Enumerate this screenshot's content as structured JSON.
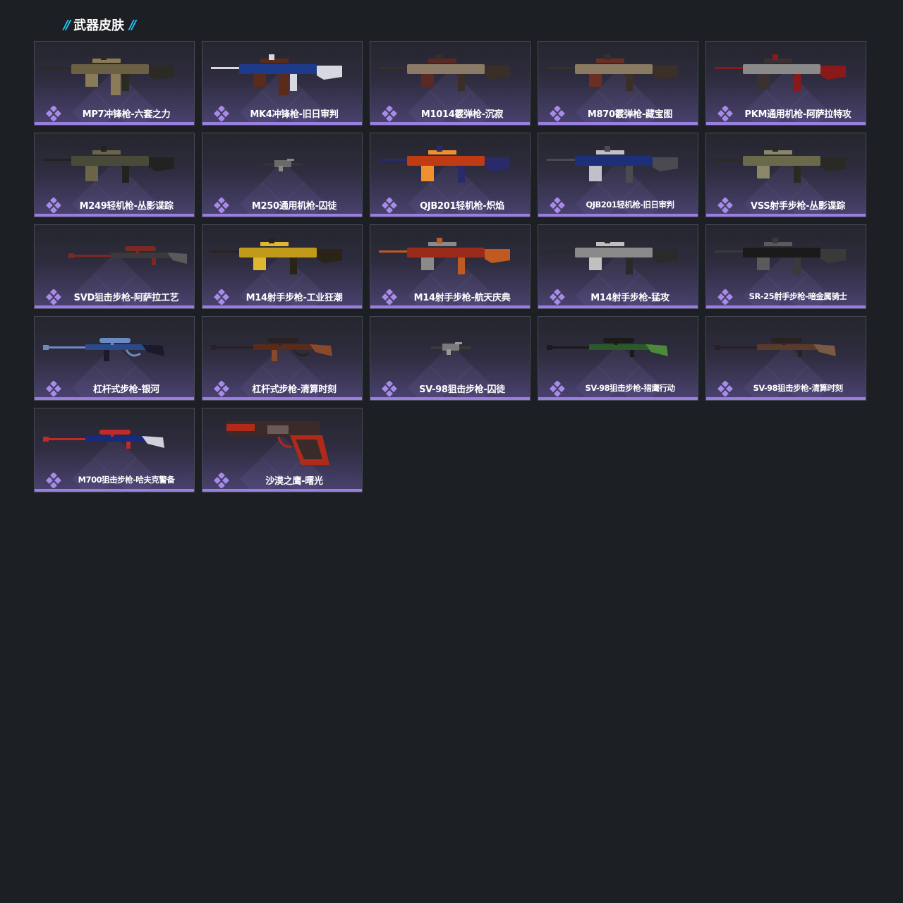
{
  "section": {
    "title": "武器皮肤",
    "accent_color": "#22c6f0"
  },
  "colors": {
    "background": "#1c1f23",
    "card_bottom_bar": "#9a7ee0",
    "rarity_icon": "#a78be8"
  },
  "items": [
    {
      "label": "MP7冲锋枪-六套之力",
      "icon": "smg-icon",
      "weapon_kind": "smg",
      "palette": [
        "#6b6044",
        "#2c2a24",
        "#8a7a58"
      ]
    },
    {
      "label": "MK4冲锋枪-旧日审判",
      "icon": "smg-icon",
      "weapon_kind": "smg",
      "palette": [
        "#1e3a8a",
        "#d8d8e0",
        "#5a2a1a"
      ]
    },
    {
      "label": "M1014霰弹枪-沉寂",
      "icon": "shotgun-icon",
      "weapon_kind": "shotgun",
      "palette": [
        "#8a7a66",
        "#3a2e28",
        "#5a2a22"
      ]
    },
    {
      "label": "M870霰弹枪-藏宝图",
      "icon": "shotgun-icon",
      "weapon_kind": "shotgun",
      "palette": [
        "#8a7a62",
        "#3a3028",
        "#6a2e22"
      ]
    },
    {
      "label": "PKM通用机枪-阿萨拉特攻",
      "icon": "machine-gun-icon",
      "weapon_kind": "mg",
      "palette": [
        "#8a8a8a",
        "#8a1a1a",
        "#3a3030"
      ]
    },
    {
      "label": "M249轻机枪-丛影谍踪",
      "icon": "machine-gun-icon",
      "weapon_kind": "mg",
      "palette": [
        "#4a4a38",
        "#222220",
        "#6a6448"
      ]
    },
    {
      "label": "M250通用机枪-囚徒",
      "icon": "machine-gun-icon",
      "weapon_kind": "tiny",
      "palette": [
        "#6a6a6a",
        "#333333",
        "#888888"
      ]
    },
    {
      "label": "QJB201轻机枪-炽焰",
      "icon": "machine-gun-icon",
      "weapon_kind": "mg",
      "palette": [
        "#c03a14",
        "#2a2a6a",
        "#f09030"
      ]
    },
    {
      "label": "QJB201轻机枪-旧日审判",
      "icon": "machine-gun-icon",
      "weapon_kind": "mg",
      "palette": [
        "#1e2f7a",
        "#4a4a50",
        "#c0c0c8"
      ]
    },
    {
      "label": "VSS射手步枪-丛影谍踪",
      "icon": "rifle-icon",
      "weapon_kind": "rifle",
      "palette": [
        "#6a6a4a",
        "#2a2a24",
        "#8a8668"
      ]
    },
    {
      "label": "SVD狙击步枪-阿萨拉工艺",
      "icon": "sniper-icon",
      "weapon_kind": "sniper_small",
      "palette": [
        "#3a3a3a",
        "#7a2a22",
        "#5a5a5a"
      ]
    },
    {
      "label": "M14射手步枪-工业狂潮",
      "icon": "rifle-icon",
      "weapon_kind": "rifle",
      "palette": [
        "#c09a18",
        "#2a2418",
        "#e0b830"
      ]
    },
    {
      "label": "M14射手步枪-航天庆典",
      "icon": "rifle-icon",
      "weapon_kind": "rifle",
      "palette": [
        "#9a2a1a",
        "#c05a22",
        "#8a8a8a"
      ]
    },
    {
      "label": "M14射手步枪-猛攻",
      "icon": "rifle-icon",
      "weapon_kind": "rifle",
      "palette": [
        "#8a8a8a",
        "#2a2a2a",
        "#c0c0c0"
      ]
    },
    {
      "label": "SR-25射手步枪-暗金属骑士",
      "icon": "rifle-icon",
      "weapon_kind": "rifle",
      "palette": [
        "#1a1a1a",
        "#3a3a3a",
        "#5a5a5a"
      ]
    },
    {
      "label": "杠杆式步枪-银河",
      "icon": "sniper-icon",
      "weapon_kind": "lever",
      "palette": [
        "#2a4a8a",
        "#6a8ac0",
        "#1a1a2a"
      ]
    },
    {
      "label": "杠杆式步枪-清算时刻",
      "icon": "sniper-icon",
      "weapon_kind": "lever",
      "palette": [
        "#5a2a1a",
        "#2a2222",
        "#8a4a2a"
      ]
    },
    {
      "label": "SV-98狙击步枪-囚徒",
      "icon": "sniper-icon",
      "weapon_kind": "tiny",
      "palette": [
        "#7a7a7a",
        "#3a3a3a",
        "#9a9a9a"
      ]
    },
    {
      "label": "SV-98狙击步枪-猎鹰行动",
      "icon": "sniper-icon",
      "weapon_kind": "sniper",
      "palette": [
        "#2a5a2a",
        "#1a1a1a",
        "#4a8a3a"
      ]
    },
    {
      "label": "SV-98狙击步枪-清算时刻",
      "icon": "sniper-icon",
      "weapon_kind": "sniper",
      "palette": [
        "#5a3a2a",
        "#2a2222",
        "#7a5a44"
      ]
    },
    {
      "label": "M700狙击步枪-哈夫克警备",
      "icon": "sniper-icon",
      "weapon_kind": "sniper",
      "palette": [
        "#1a2a7a",
        "#c02a2a",
        "#d0d0d8"
      ]
    },
    {
      "label": "沙漠之鹰-曙光",
      "icon": "pistol-icon",
      "weapon_kind": "pistol",
      "palette": [
        "#3a2a2a",
        "#b02a1a",
        "#6a5a5a"
      ]
    }
  ]
}
